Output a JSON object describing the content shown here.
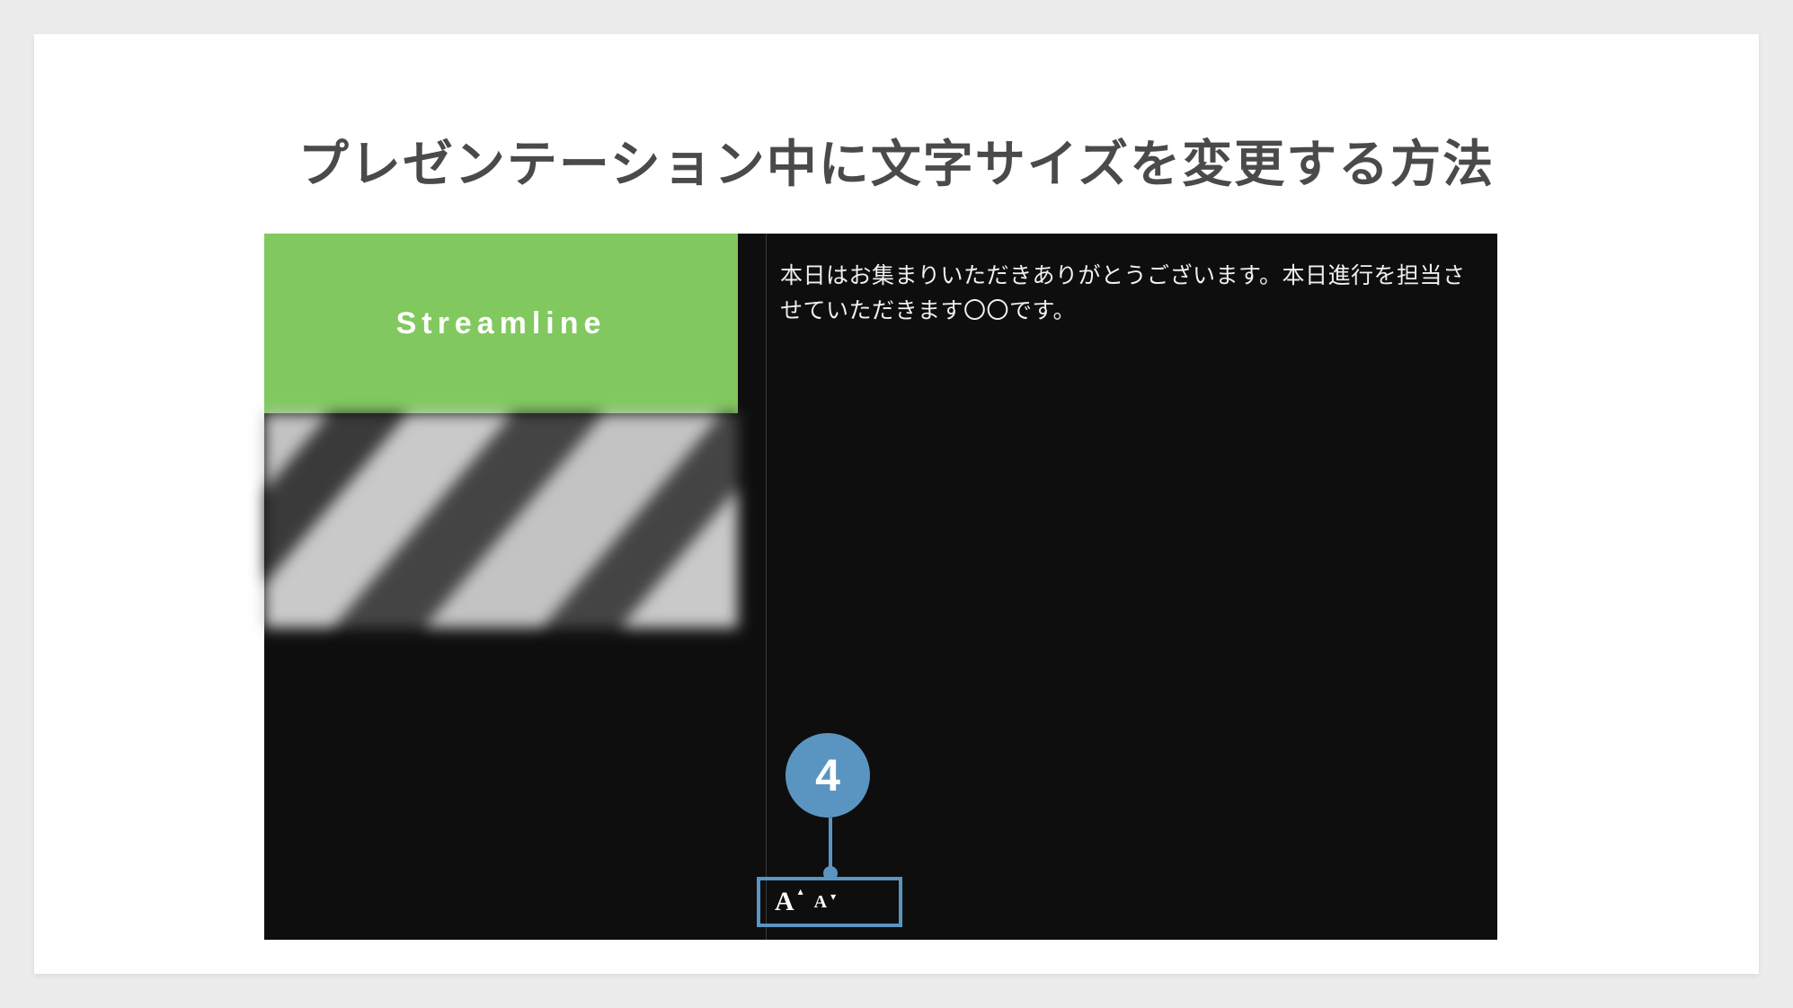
{
  "title": "プレゼンテーション中に文字サイズを変更する方法",
  "slide": {
    "header": "Streamline",
    "notes": "本日はお集まりいただきありがとうございます。本日進行を担当させていただきます〇〇です。"
  },
  "callout": {
    "number": "4"
  },
  "controls": {
    "increase": "A",
    "decrease": "A"
  }
}
